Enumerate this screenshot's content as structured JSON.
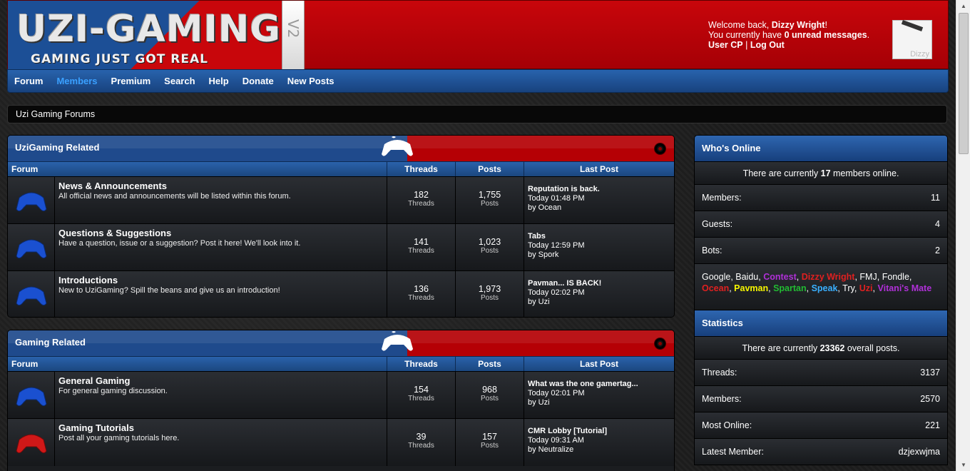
{
  "site": {
    "logo_text": "UZI-GAMING",
    "logo_tagline": "GAMING JUST GOT REAL",
    "logo_version": "V2"
  },
  "welcome": {
    "line1_prefix": "Welcome back, ",
    "username": "Dizzy Wright",
    "line1_suffix": "!",
    "line2_prefix": "You currently have ",
    "unread_count": "0 unread messages",
    "line2_suffix": ".",
    "usercp": "User CP",
    "separator": "|",
    "logout": "Log Out",
    "avatar_name": "Dizzy"
  },
  "nav": {
    "items": [
      "Forum",
      "Members",
      "Premium",
      "Search",
      "Help",
      "Donate",
      "New Posts"
    ]
  },
  "breadcrumb": "Uzi Gaming Forums",
  "columns": {
    "forum": "Forum",
    "threads": "Threads",
    "posts": "Posts",
    "last_post": "Last Post"
  },
  "categories": [
    {
      "title": "UziGaming Related",
      "forums": [
        {
          "title": "News & Announcements",
          "desc": "All official news and announcements will be listed within this forum.",
          "threads": "182",
          "threads_label": "Threads",
          "posts": "1,755",
          "posts_label": "Posts",
          "last_title": "Reputation is back.",
          "last_time": "Today 01:48 PM",
          "last_by": "by Ocean",
          "icon_color": "#1a50d0"
        },
        {
          "title": "Questions & Suggestions",
          "desc": "Have a question, issue or a suggestion? Post it here! We'll look into it.",
          "threads": "141",
          "threads_label": "Threads",
          "posts": "1,023",
          "posts_label": "Posts",
          "last_title": "Tabs",
          "last_time": "Today 12:59 PM",
          "last_by": "by Spork",
          "icon_color": "#1a50d0"
        },
        {
          "title": "Introductions",
          "desc": "New to UziGaming? Spill the beans and give us an introduction!",
          "threads": "136",
          "threads_label": "Threads",
          "posts": "1,973",
          "posts_label": "Posts",
          "last_title": "Pavman... IS BACK!",
          "last_time": "Today 02:02 PM",
          "last_by": "by Uzi",
          "icon_color": "#1a50d0"
        }
      ]
    },
    {
      "title": "Gaming Related",
      "forums": [
        {
          "title": "General Gaming",
          "desc": "For general gaming discussion.",
          "threads": "154",
          "threads_label": "Threads",
          "posts": "968",
          "posts_label": "Posts",
          "last_title": "What was the one gamertag...",
          "last_time": "Today 02:01 PM",
          "last_by": "by Uzi",
          "icon_color": "#1a50d0"
        },
        {
          "title": "Gaming Tutorials",
          "desc": "Post all your gaming tutorials here.",
          "threads": "39",
          "threads_label": "Threads",
          "posts": "157",
          "posts_label": "Posts",
          "last_title": "CMR Lobby [Tutorial]",
          "last_time": "Today 09:31 AM",
          "last_by": "by Neutralize",
          "icon_color": "#d01818"
        }
      ]
    }
  ],
  "whos_online": {
    "title": "Who's Online",
    "summary_prefix": "There are currently ",
    "summary_count": "17",
    "summary_suffix": " members online.",
    "rows": [
      {
        "label": "Members:",
        "value": "11"
      },
      {
        "label": "Guests:",
        "value": "4"
      },
      {
        "label": "Bots:",
        "value": "2"
      }
    ],
    "users": [
      {
        "name": "Google",
        "class": "u-plain"
      },
      {
        "name": "Baidu",
        "class": "u-plain"
      },
      {
        "name": "Contest",
        "class": "u-purple"
      },
      {
        "name": "Dizzy Wright",
        "class": "u-red"
      },
      {
        "name": "FMJ",
        "class": "u-plain"
      },
      {
        "name": "Fondle",
        "class": "u-plain"
      },
      {
        "name": "Ocean",
        "class": "u-red"
      },
      {
        "name": "Pavman",
        "class": "u-yellow"
      },
      {
        "name": "Spartan",
        "class": "u-green"
      },
      {
        "name": "Speak",
        "class": "u-blue"
      },
      {
        "name": "Try",
        "class": "u-plain"
      },
      {
        "name": "Uzi",
        "class": "u-red"
      },
      {
        "name": "Vitani's Mate",
        "class": "u-purple"
      }
    ]
  },
  "statistics": {
    "title": "Statistics",
    "summary_prefix": "There are currently ",
    "summary_count": "23362",
    "summary_suffix": " overall posts.",
    "rows": [
      {
        "label": "Threads:",
        "value": "3137"
      },
      {
        "label": "Members:",
        "value": "2570"
      },
      {
        "label": "Most Online:",
        "value": "221"
      },
      {
        "label": "Latest Member:",
        "value": "dzjexwjma"
      }
    ]
  },
  "colors": {
    "header_red": "#c8060b",
    "nav_blue": "#2863ad",
    "active_link": "#3aa0ff"
  }
}
